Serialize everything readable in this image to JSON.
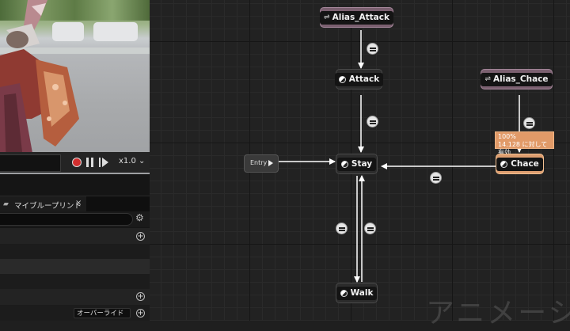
{
  "viewport": {
    "toolbar": {
      "speed_label": "x1.0",
      "record_icon": "record-icon",
      "pause_icon": "pause-icon",
      "step_icon": "step-forward-icon"
    }
  },
  "panel": {
    "tab": {
      "label": "マイブループリント",
      "close": "×",
      "icon": "folder-icon"
    },
    "search": {
      "placeholder": ""
    },
    "override_label": "オーバーライド"
  },
  "graph": {
    "entry_label": "Entry",
    "nodes": {
      "alias_attack": "Alias_Attack",
      "attack": "Attack",
      "alias_chace": "Alias_Chace",
      "stay": "Stay",
      "chace": "Chace",
      "walk": "Walk"
    },
    "tooltip": {
      "line1": "100%",
      "line2": "14.128 に対して有効"
    },
    "watermark": "アニメーシ",
    "colors": {
      "alias_node": "#7b6070",
      "active_node": "#dc9d6f",
      "record": "#d32f2f"
    }
  }
}
